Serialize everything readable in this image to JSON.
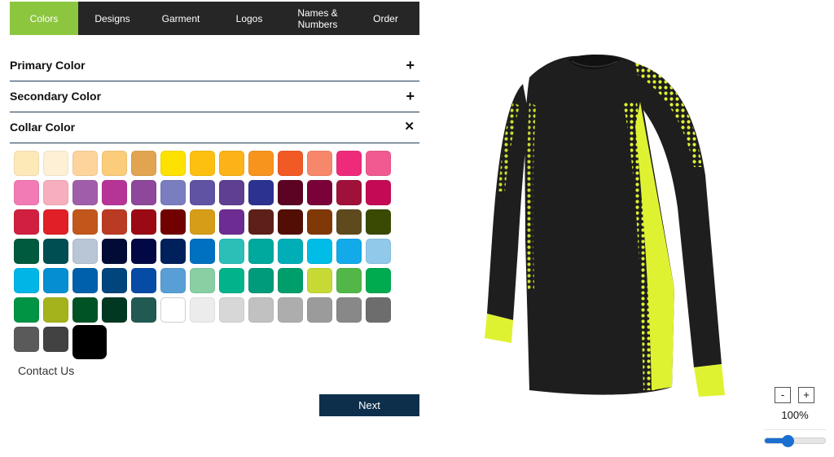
{
  "nav": {
    "tabs": [
      {
        "label": "Colors",
        "active": true
      },
      {
        "label": "Designs",
        "active": false
      },
      {
        "label": "Garment",
        "active": false
      },
      {
        "label": "Logos",
        "active": false
      },
      {
        "label": "Names &\nNumbers",
        "active": false
      },
      {
        "label": "Order",
        "active": false
      }
    ]
  },
  "accordion": [
    {
      "label": "Primary Color",
      "icon": "plus-icon",
      "symbol": "+"
    },
    {
      "label": "Secondary Color",
      "icon": "plus-icon",
      "symbol": "+"
    },
    {
      "label": "Collar Color",
      "icon": "close-icon",
      "symbol": "✕"
    }
  ],
  "swatches": {
    "selected_index": 80,
    "colors": [
      "#fde8b8",
      "#fdf0d5",
      "#fcd49c",
      "#fbcc79",
      "#e1a551",
      "#fde100",
      "#fdc010",
      "#fcb318",
      "#f7941d",
      "#f15a24",
      "#f7876b",
      "#ee2b7b",
      "#f05a91",
      "#f27ab5",
      "#f7aebd",
      "#a05eaa",
      "#b73497",
      "#8e479b",
      "#7b7dc1",
      "#6053a3",
      "#5f3f91",
      "#2b3290",
      "#5c0222",
      "#7a0239",
      "#a0113a",
      "#c50a55",
      "#d11f3f",
      "#e01f26",
      "#c1571b",
      "#bb3a24",
      "#9b0a14",
      "#710000",
      "#d69d18",
      "#6c2c91",
      "#5d2019",
      "#520e05",
      "#803906",
      "#5e4a1d",
      "#3b4a02",
      "#005a3d",
      "#004e51",
      "#b8c6d6",
      "#010b35",
      "#020844",
      "#00205c",
      "#0071c1",
      "#2bbfb8",
      "#00a99d",
      "#00aeb8",
      "#00bde8",
      "#12aae8",
      "#90c9ea",
      "#00b6e7",
      "#058fd2",
      "#0060ab",
      "#00457d",
      "#064ba6",
      "#589fd6",
      "#88d0a4",
      "#00b38a",
      "#009b7a",
      "#009e6b",
      "#c6d935",
      "#52b748",
      "#00aa4f",
      "#009444",
      "#a4b31c",
      "#005325",
      "#003822",
      "#225a53",
      "#ffffff",
      "#ececec",
      "#d7d7d7",
      "#c1c1c1",
      "#adadad",
      "#9b9b9b",
      "#888888",
      "#6d6d6d",
      "#5a5a5a",
      "#424242",
      "#000000"
    ]
  },
  "contact": {
    "label": "Contact Us"
  },
  "next_button": {
    "label": "Next"
  },
  "preview": {
    "garment": "long-sleeve-jersey",
    "body_color": "#1e1e1e",
    "accent_color": "#dff232"
  },
  "zoom": {
    "minus_label": "-",
    "plus_label": "+",
    "percent_label": "100%",
    "level_fraction": 0.37
  }
}
